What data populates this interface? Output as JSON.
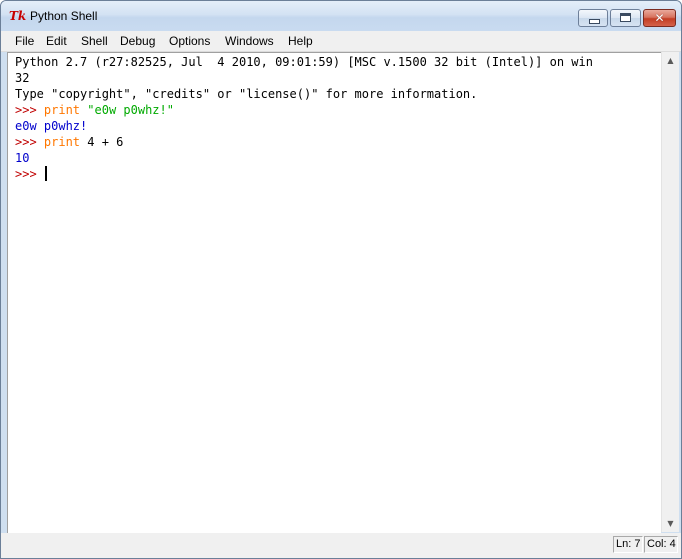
{
  "window": {
    "title": "Python Shell",
    "icon_text": "Tk"
  },
  "menu": {
    "file": "File",
    "edit": "Edit",
    "shell": "Shell",
    "debug": "Debug",
    "options": "Options",
    "windows": "Windows",
    "help": "Help"
  },
  "shell": {
    "banner_line1": "Python 2.7 (r27:82525, Jul  4 2010, 09:01:59) [MSC v.1500 32 bit (Intel)] on win",
    "banner_line2": "32",
    "banner_line3": "Type \"copyright\", \"credits\" or \"license()\" for more information.",
    "prompt": ">>> ",
    "cmd1_keyword": "print",
    "cmd1_string": "\"e0w p0whz!\"",
    "output1": "e0w p0whz!",
    "cmd2_keyword": "print",
    "cmd2_expr": " 4 + 6",
    "output2": "10"
  },
  "status": {
    "line": "Ln: 7",
    "col": "Col: 4"
  },
  "colors": {
    "prompt": "#c00000",
    "keyword": "#ff7700",
    "string": "#00aa00",
    "stdout": "#0000cc"
  }
}
